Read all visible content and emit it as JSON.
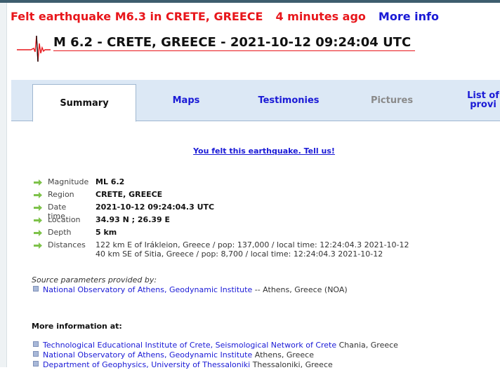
{
  "banner": {
    "felt": "Felt earthquake M6.3 in CRETE, GREECE",
    "ago": "4 minutes ago",
    "more": "More info"
  },
  "event_title": "M 6.2 - CRETE, GREECE - 2021-10-12 09:24:04 UTC",
  "tabs": [
    {
      "label": "Summary"
    },
    {
      "label": "Maps"
    },
    {
      "label": "Testimonies"
    },
    {
      "label": "Pictures"
    },
    {
      "label": "List of provi"
    }
  ],
  "felt_link": "You felt this earthquake. Tell us!",
  "params": {
    "magnitude": {
      "label": "Magnitude",
      "value": "ML 6.2"
    },
    "region": {
      "label": "Region",
      "value": "CRETE, GREECE"
    },
    "datetime": {
      "label": "Date time",
      "value": "2021-10-12 09:24:04.3 UTC"
    },
    "location": {
      "label": "Location",
      "value": "34.93 N ; 26.39 E"
    },
    "depth": {
      "label": "Depth",
      "value": "5 km"
    },
    "distances": {
      "label": "Distances",
      "line1": "122 km E of Irákleion, Greece / pop: 137,000 / local time: 12:24:04.3 2021-10-12",
      "line2": "40 km SE of Sitia, Greece / pop: 8,700 / local time: 12:24:04.3 2021-10-12"
    }
  },
  "source": {
    "heading": "Source parameters provided by:",
    "link": "National Observatory of Athens, Geodynamic Institute",
    "suffix": "-- Athens, Greece (NOA)"
  },
  "more_info": {
    "heading": "More information at:",
    "items": [
      {
        "link": "Technological Educational Institute of Crete, Seismological Network of Crete",
        "place": "Chania, Greece"
      },
      {
        "link": "National Observatory of Athens, Geodynamic Institute",
        "place": "Athens, Greece"
      },
      {
        "link": "Department of Geophysics, University of Thessaloniki",
        "place": "Thessaloniki, Greece"
      }
    ]
  },
  "colors": {
    "alert": "#e8161b",
    "link": "#1a1ad6",
    "tabbar": "#dce8f5",
    "arrow": "#7ec24a"
  }
}
